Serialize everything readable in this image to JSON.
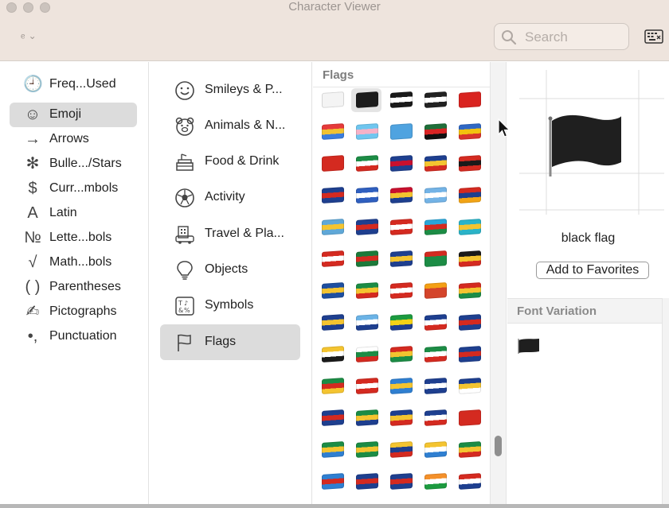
{
  "window": {
    "title": "Character Viewer"
  },
  "search": {
    "placeholder": "Search"
  },
  "sidebar": {
    "items": [
      {
        "label": "Freq...Used",
        "icon": "clock-icon",
        "glyph": "🕘"
      },
      {
        "label": "Emoji",
        "icon": "smiley-icon",
        "glyph": "☺"
      },
      {
        "label": "Arrows",
        "icon": "arrow-icon",
        "glyph": "→"
      },
      {
        "label": "Bulle.../Stars",
        "icon": "star-icon",
        "glyph": "✻"
      },
      {
        "label": "Curr...mbols",
        "icon": "dollar-icon",
        "glyph": "$"
      },
      {
        "label": "Latin",
        "icon": "latin-a-icon",
        "glyph": "A"
      },
      {
        "label": "Lette...bols",
        "icon": "numero-icon",
        "glyph": "№"
      },
      {
        "label": "Math...bols",
        "icon": "sqrt-icon",
        "glyph": "√"
      },
      {
        "label": "Parentheses",
        "icon": "parentheses-icon",
        "glyph": "( )"
      },
      {
        "label": "Pictographs",
        "icon": "pencil-icon",
        "glyph": "✍"
      },
      {
        "label": "Punctuation",
        "icon": "punctuation-icon",
        "glyph": "•,"
      }
    ],
    "active_index": 1
  },
  "categories": {
    "items": [
      {
        "label": "Smileys & P...",
        "icon": "smiley-face-icon"
      },
      {
        "label": "Animals & N...",
        "icon": "bear-icon"
      },
      {
        "label": "Food & Drink",
        "icon": "cake-icon"
      },
      {
        "label": "Activity",
        "icon": "soccer-ball-icon"
      },
      {
        "label": "Travel & Pla...",
        "icon": "building-icon"
      },
      {
        "label": "Objects",
        "icon": "lightbulb-icon"
      },
      {
        "label": "Symbols",
        "icon": "symbols-icon"
      },
      {
        "label": "Flags",
        "icon": "flag-icon"
      }
    ],
    "active_index": 7
  },
  "grid": {
    "header": "Flags",
    "rows": [
      [
        [
          "#f4f4f4",
          "#f4f4f4",
          "#f4f4f4"
        ],
        [
          "#1c1c1c",
          "#1c1c1c",
          "#1c1c1c"
        ],
        [
          "#1a1a1a",
          "#ffffff",
          "#1a1a1a"
        ],
        [
          "#222222",
          "#ffffff",
          "#222222"
        ],
        [
          "#d9231f",
          "#d9231f",
          "#d9231f"
        ]
      ],
      [
        [
          "#e63a3a",
          "#f1c232",
          "#3b7ddd"
        ],
        [
          "#6fc6ef",
          "#f5b2c8",
          "#6fc6ef"
        ],
        [
          "#4fa3e0",
          "#4fa3e0",
          "#4fa3e0"
        ],
        [
          "#1f6f3a",
          "#d92424",
          "#111111"
        ],
        [
          "#2f67c4",
          "#f2c10f",
          "#d8332c"
        ]
      ],
      [
        [
          "#d42a20",
          "#d42a20",
          "#d42a20"
        ],
        [
          "#1c8c45",
          "#ffffff",
          "#d42a20"
        ],
        [
          "#1e3f8f",
          "#c8102e",
          "#1e3f8f"
        ],
        [
          "#1e3f8f",
          "#f4c430",
          "#d42a20"
        ],
        [
          "#d42a20",
          "#1a1a1a",
          "#d42a20"
        ]
      ],
      [
        [
          "#1e3f8f",
          "#d42a20",
          "#1e3f8f"
        ],
        [
          "#2f5fbf",
          "#ffffff",
          "#2f5fbf"
        ],
        [
          "#c8102e",
          "#f4c430",
          "#1e3f8f"
        ],
        [
          "#73b3e6",
          "#ffffff",
          "#73b3e6"
        ],
        [
          "#d42a20",
          "#1e3f8f",
          "#f2a415"
        ]
      ],
      [
        [
          "#5fa8d8",
          "#f4c430",
          "#5fa8d8"
        ],
        [
          "#1e3f8f",
          "#d42a20",
          "#1e3f8f"
        ],
        [
          "#d42a20",
          "#ffffff",
          "#d42a20"
        ],
        [
          "#2aa6d8",
          "#d42a20",
          "#1c8c45"
        ],
        [
          "#2ab3c8",
          "#f4c430",
          "#2ab3c8"
        ]
      ],
      [
        [
          "#d42a20",
          "#ffffff",
          "#d42a20"
        ],
        [
          "#1c7a3a",
          "#d42a20",
          "#1c7a3a"
        ],
        [
          "#1e3f8f",
          "#f4c430",
          "#1e3f8f"
        ],
        [
          "#d42a20",
          "#1c8c45",
          "#1c8c45"
        ],
        [
          "#1a1a1a",
          "#f4c430",
          "#d42a20"
        ]
      ],
      [
        [
          "#1e4fa0",
          "#f4c430",
          "#1e4fa0"
        ],
        [
          "#1c8c45",
          "#f4c430",
          "#d42a20"
        ],
        [
          "#d42a20",
          "#ffffff",
          "#d42a20"
        ],
        [
          "#f4a015",
          "#d4442a",
          "#d4442a"
        ],
        [
          "#d42a20",
          "#f4c430",
          "#1c8c45"
        ]
      ],
      [
        [
          "#1e3f8f",
          "#f4c430",
          "#1e3f8f"
        ],
        [
          "#6bb3e6",
          "#ffffff",
          "#1e3f8f"
        ],
        [
          "#1c9a3f",
          "#f4d316",
          "#1e3f8f"
        ],
        [
          "#1e3f8f",
          "#ffffff",
          "#d42a20"
        ],
        [
          "#1e3f8f",
          "#d42a20",
          "#1e3f8f"
        ]
      ],
      [
        [
          "#f4c430",
          "#ffffff",
          "#1a1a1a"
        ],
        [
          "#ffffff",
          "#1c8c45",
          "#d42a20"
        ],
        [
          "#d42a20",
          "#f4c430",
          "#1c8c45"
        ],
        [
          "#1c8c45",
          "#ffffff",
          "#d42a20"
        ],
        [
          "#1e3f8f",
          "#d42a20",
          "#1e3f8f"
        ]
      ],
      [
        [
          "#1c8c45",
          "#d42a20",
          "#f4c430"
        ],
        [
          "#d42a20",
          "#ffffff",
          "#d42a20"
        ],
        [
          "#2f7fd1",
          "#f4c430",
          "#2f7fd1"
        ],
        [
          "#1e3f8f",
          "#ffffff",
          "#1e3f8f"
        ],
        [
          "#1e3f8f",
          "#f4c430",
          "#ffffff"
        ]
      ],
      [
        [
          "#1e3f8f",
          "#d42a20",
          "#1e3f8f"
        ],
        [
          "#1c8c45",
          "#f4c430",
          "#1e3f8f"
        ],
        [
          "#1e3f8f",
          "#f4c430",
          "#d42a20"
        ],
        [
          "#1e3f8f",
          "#ffffff",
          "#d42a20"
        ],
        [
          "#d42a20",
          "#d42a20",
          "#d42a20"
        ]
      ],
      [
        [
          "#1c8c45",
          "#f4c430",
          "#2f7fd1"
        ],
        [
          "#1c8c45",
          "#f4c430",
          "#1c8c45"
        ],
        [
          "#f4c430",
          "#1e3f8f",
          "#d42a20"
        ],
        [
          "#f4c430",
          "#ffffff",
          "#2f7fd1"
        ],
        [
          "#1c8c45",
          "#f4c430",
          "#d42a20"
        ]
      ],
      [
        [
          "#2f7fd1",
          "#d42a20",
          "#2f7fd1"
        ],
        [
          "#1e3f8f",
          "#d42a20",
          "#1e3f8f"
        ],
        [
          "#1e3f8f",
          "#d42a20",
          "#1e3f8f"
        ],
        [
          "#f4902a",
          "#ffffff",
          "#1c9a3f"
        ],
        [
          "#d42a20",
          "#ffffff",
          "#1e3f8f"
        ]
      ]
    ]
  },
  "preview": {
    "name": "black flag",
    "add_favorites_label": "Add to Favorites",
    "flag_color": "#1f1f1f"
  },
  "variation": {
    "header": "Font Variation"
  }
}
